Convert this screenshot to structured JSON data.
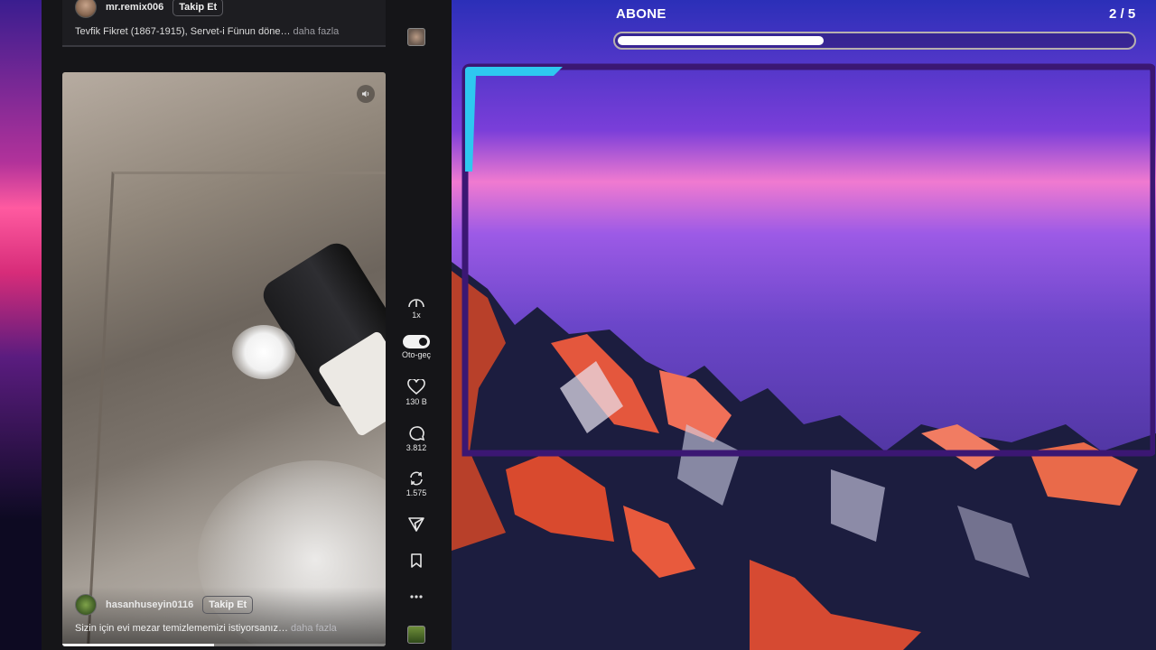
{
  "top_post": {
    "author": "mr.remix006",
    "follow_label": "Takip Et",
    "caption": "Tevfik Fikret (1867-1915), Servet-i Fünun döne…",
    "more_label": "daha fazla"
  },
  "video_post": {
    "author": "hasanhuseyin0116",
    "follow_label": "Takip Et",
    "caption": "Sizin için evi mezar temizlememizi istiyorsanız…",
    "more_label": "daha fazla",
    "progress_fraction": 0.47
  },
  "actions": {
    "speed": "1x",
    "autoplay": "Oto-geç",
    "likes": "130 B",
    "comments": "3.812",
    "reposts": "1.575"
  },
  "quest": {
    "title": "ABONE",
    "count": "2 / 5",
    "progress_fraction": 0.4
  },
  "colors": {
    "frame_accent": "#2ec8f0",
    "frame_border": "#3b1773",
    "panel_bg": "#151518"
  },
  "icons": [
    "more-icon",
    "volume-icon",
    "speedometer-icon",
    "heart-icon",
    "comment-icon",
    "repost-icon",
    "share-icon",
    "bookmark-icon"
  ]
}
